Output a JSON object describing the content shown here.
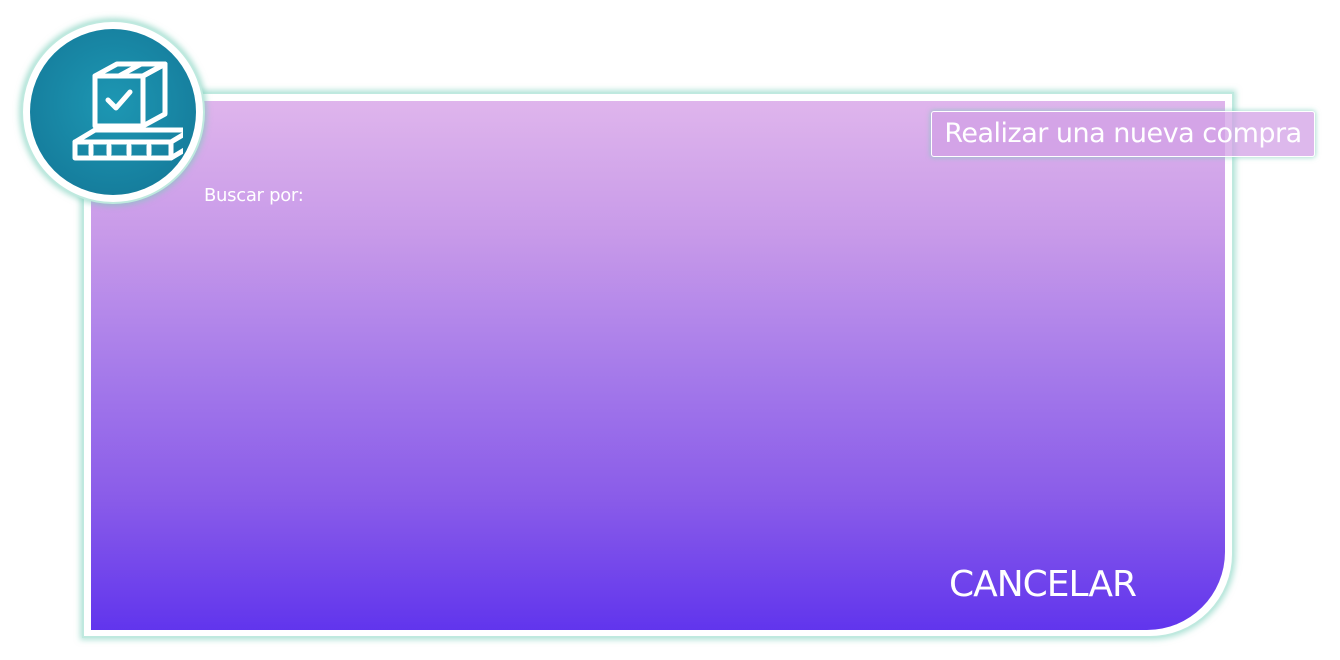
{
  "header": {
    "new_purchase_label": "Realizar una nueva compra",
    "logo_icon": "box-on-pallet-check-icon"
  },
  "search": {
    "label": "Buscar por:"
  },
  "footer": {
    "cancel_label": "CANCELAR"
  },
  "colors": {
    "gradient_top": "#dfb5ec",
    "gradient_bottom": "#6135ed",
    "logo_bg": "#167f9e",
    "frame_border": "#bfe9df"
  }
}
